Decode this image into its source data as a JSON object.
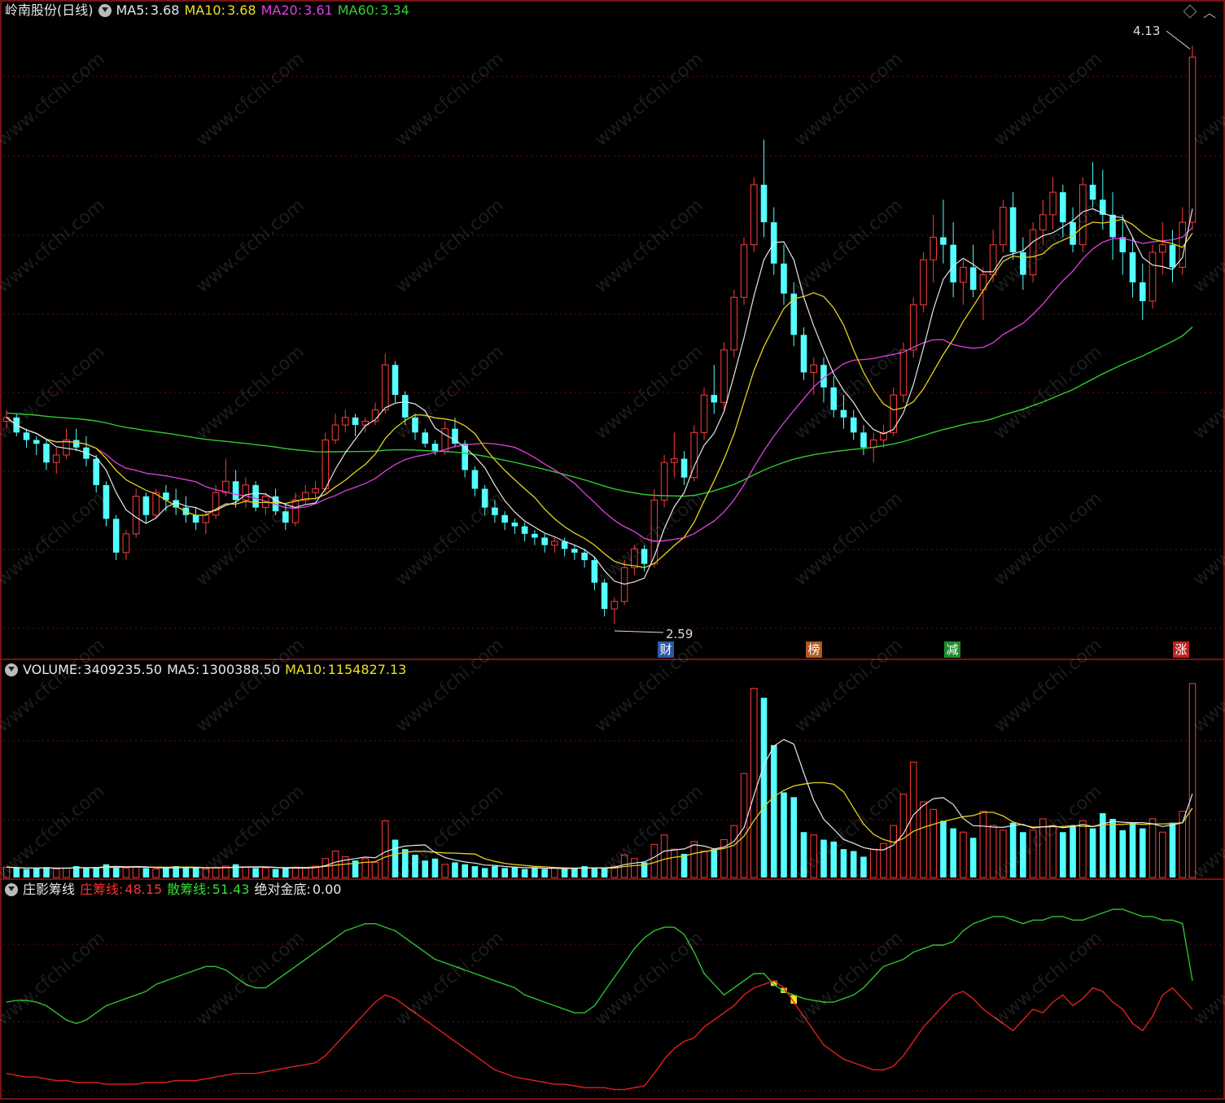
{
  "header": {
    "name": "岭南股份(日线)",
    "ma5_label": "MA5:",
    "ma5": "3.68",
    "ma10_label": "MA10:",
    "ma10": "3.68",
    "ma20_label": "MA20:",
    "ma20": "3.61",
    "ma60_label": "MA60:",
    "ma60": "3.34"
  },
  "volume_header": {
    "vol_label": "VOLUME:",
    "vol": "3409235.50",
    "ma5_label": "MA5:",
    "ma5": "1300388.50",
    "ma10_label": "MA10:",
    "ma10": "1154827.13"
  },
  "indicator_header": {
    "name": "庄影筹线",
    "zhuang_label": "庄筹线:",
    "zhuang": "48.15",
    "san_label": "散筹线:",
    "san": "51.43",
    "jd_label": "绝对金底:",
    "jd": "0.00"
  },
  "annotations": {
    "high": "4.13",
    "low": "2.59"
  },
  "tags": [
    {
      "text": "财",
      "bg": "#2a5aa8"
    },
    {
      "text": "榜",
      "bg": "#b05a20"
    },
    {
      "text": "减",
      "bg": "#208a30"
    },
    {
      "text": "涨",
      "bg": "#c02020"
    }
  ],
  "watermark": "www.cfchi.com",
  "colors": {
    "up": "#ff3b3b",
    "down": "#54ffff",
    "ma5": "#e8e8e8",
    "ma10": "#e6d21e",
    "ma20": "#e040e0",
    "ma60": "#2ecc2e",
    "border": "#a01818"
  },
  "chart_data": [
    {
      "type": "candlestick",
      "title": "岭南股份(日线)",
      "ylim": [
        2.5,
        4.2
      ],
      "count": 125,
      "ohlc": [
        [
          3.13,
          3.16,
          3.11,
          3.14
        ],
        [
          3.14,
          3.15,
          3.09,
          3.1
        ],
        [
          3.1,
          3.11,
          3.06,
          3.08
        ],
        [
          3.08,
          3.09,
          3.04,
          3.07
        ],
        [
          3.07,
          3.08,
          3.0,
          3.02
        ],
        [
          3.02,
          3.06,
          2.99,
          3.04
        ],
        [
          3.04,
          3.11,
          3.03,
          3.08
        ],
        [
          3.08,
          3.11,
          3.05,
          3.06
        ],
        [
          3.06,
          3.09,
          3.01,
          3.03
        ],
        [
          3.03,
          3.04,
          2.94,
          2.96
        ],
        [
          2.96,
          2.97,
          2.85,
          2.87
        ],
        [
          2.87,
          2.88,
          2.76,
          2.78
        ],
        [
          2.78,
          2.84,
          2.76,
          2.83
        ],
        [
          2.83,
          2.95,
          2.82,
          2.93
        ],
        [
          2.93,
          2.94,
          2.86,
          2.88
        ],
        [
          2.88,
          2.95,
          2.87,
          2.94
        ],
        [
          2.94,
          2.96,
          2.89,
          2.92
        ],
        [
          2.92,
          2.95,
          2.88,
          2.9
        ],
        [
          2.9,
          2.93,
          2.86,
          2.88
        ],
        [
          2.88,
          2.9,
          2.84,
          2.86
        ],
        [
          2.86,
          2.89,
          2.83,
          2.88
        ],
        [
          2.88,
          2.96,
          2.87,
          2.94
        ],
        [
          2.94,
          3.03,
          2.93,
          2.97
        ],
        [
          2.97,
          3.0,
          2.9,
          2.92
        ],
        [
          2.92,
          2.98,
          2.9,
          2.96
        ],
        [
          2.96,
          2.97,
          2.89,
          2.9
        ],
        [
          2.9,
          2.94,
          2.88,
          2.93
        ],
        [
          2.93,
          2.95,
          2.88,
          2.89
        ],
        [
          2.89,
          2.91,
          2.84,
          2.86
        ],
        [
          2.86,
          2.94,
          2.85,
          2.92
        ],
        [
          2.92,
          2.96,
          2.91,
          2.94
        ],
        [
          2.94,
          2.97,
          2.92,
          2.95
        ],
        [
          2.95,
          3.1,
          2.94,
          3.08
        ],
        [
          3.08,
          3.15,
          3.07,
          3.12
        ],
        [
          3.12,
          3.16,
          3.1,
          3.14
        ],
        [
          3.14,
          3.15,
          3.09,
          3.12
        ],
        [
          3.12,
          3.14,
          3.1,
          3.13
        ],
        [
          3.13,
          3.18,
          3.12,
          3.16
        ],
        [
          3.16,
          3.31,
          3.15,
          3.28
        ],
        [
          3.28,
          3.29,
          3.18,
          3.2
        ],
        [
          3.2,
          3.21,
          3.12,
          3.14
        ],
        [
          3.14,
          3.15,
          3.08,
          3.1
        ],
        [
          3.1,
          3.11,
          3.06,
          3.07
        ],
        [
          3.07,
          3.08,
          3.04,
          3.05
        ],
        [
          3.05,
          3.13,
          3.04,
          3.11
        ],
        [
          3.11,
          3.14,
          3.06,
          3.07
        ],
        [
          3.07,
          3.08,
          2.98,
          3.0
        ],
        [
          3.0,
          3.01,
          2.93,
          2.95
        ],
        [
          2.95,
          2.96,
          2.88,
          2.9
        ],
        [
          2.9,
          2.92,
          2.86,
          2.88
        ],
        [
          2.88,
          2.89,
          2.84,
          2.86
        ],
        [
          2.86,
          2.87,
          2.83,
          2.85
        ],
        [
          2.85,
          2.86,
          2.81,
          2.83
        ],
        [
          2.83,
          2.84,
          2.8,
          2.82
        ],
        [
          2.82,
          2.83,
          2.78,
          2.8
        ],
        [
          2.8,
          2.82,
          2.78,
          2.81
        ],
        [
          2.81,
          2.82,
          2.77,
          2.79
        ],
        [
          2.79,
          2.8,
          2.76,
          2.78
        ],
        [
          2.78,
          2.79,
          2.74,
          2.76
        ],
        [
          2.76,
          2.77,
          2.68,
          2.7
        ],
        [
          2.7,
          2.71,
          2.61,
          2.63
        ],
        [
          2.63,
          2.66,
          2.59,
          2.65
        ],
        [
          2.65,
          2.76,
          2.64,
          2.74
        ],
        [
          2.74,
          2.8,
          2.72,
          2.79
        ],
        [
          2.79,
          2.8,
          2.73,
          2.75
        ],
        [
          2.75,
          2.95,
          2.74,
          2.92
        ],
        [
          2.92,
          3.04,
          2.9,
          3.02
        ],
        [
          3.02,
          3.1,
          2.98,
          3.03
        ],
        [
          3.03,
          3.05,
          2.96,
          2.98
        ],
        [
          2.98,
          3.12,
          2.97,
          3.1
        ],
        [
          3.1,
          3.22,
          3.08,
          3.2
        ],
        [
          3.2,
          3.28,
          3.15,
          3.18
        ],
        [
          3.18,
          3.34,
          3.16,
          3.32
        ],
        [
          3.32,
          3.48,
          3.3,
          3.46
        ],
        [
          3.46,
          3.62,
          3.44,
          3.6
        ],
        [
          3.6,
          3.78,
          3.58,
          3.76
        ],
        [
          3.76,
          3.88,
          3.62,
          3.66
        ],
        [
          3.66,
          3.7,
          3.52,
          3.55
        ],
        [
          3.55,
          3.6,
          3.44,
          3.47
        ],
        [
          3.47,
          3.5,
          3.33,
          3.36
        ],
        [
          3.36,
          3.38,
          3.24,
          3.26
        ],
        [
          3.26,
          3.3,
          3.2,
          3.28
        ],
        [
          3.28,
          3.3,
          3.18,
          3.22
        ],
        [
          3.22,
          3.25,
          3.14,
          3.16
        ],
        [
          3.16,
          3.2,
          3.11,
          3.14
        ],
        [
          3.14,
          3.16,
          3.08,
          3.1
        ],
        [
          3.1,
          3.12,
          3.04,
          3.06
        ],
        [
          3.06,
          3.1,
          3.02,
          3.08
        ],
        [
          3.08,
          3.12,
          3.06,
          3.1
        ],
        [
          3.1,
          3.22,
          3.09,
          3.2
        ],
        [
          3.2,
          3.34,
          3.18,
          3.32
        ],
        [
          3.32,
          3.46,
          3.3,
          3.44
        ],
        [
          3.44,
          3.58,
          3.42,
          3.56
        ],
        [
          3.56,
          3.68,
          3.5,
          3.62
        ],
        [
          3.62,
          3.72,
          3.55,
          3.6
        ],
        [
          3.6,
          3.66,
          3.46,
          3.5
        ],
        [
          3.5,
          3.56,
          3.44,
          3.54
        ],
        [
          3.54,
          3.6,
          3.46,
          3.48
        ],
        [
          3.48,
          3.54,
          3.4,
          3.52
        ],
        [
          3.52,
          3.64,
          3.5,
          3.6
        ],
        [
          3.6,
          3.72,
          3.58,
          3.7
        ],
        [
          3.7,
          3.74,
          3.56,
          3.58
        ],
        [
          3.58,
          3.62,
          3.48,
          3.52
        ],
        [
          3.52,
          3.66,
          3.5,
          3.64
        ],
        [
          3.64,
          3.72,
          3.6,
          3.68
        ],
        [
          3.68,
          3.78,
          3.64,
          3.74
        ],
        [
          3.74,
          3.76,
          3.62,
          3.66
        ],
        [
          3.66,
          3.7,
          3.58,
          3.6
        ],
        [
          3.6,
          3.78,
          3.58,
          3.76
        ],
        [
          3.76,
          3.82,
          3.7,
          3.72
        ],
        [
          3.72,
          3.8,
          3.64,
          3.68
        ],
        [
          3.68,
          3.74,
          3.56,
          3.62
        ],
        [
          3.62,
          3.68,
          3.52,
          3.58
        ],
        [
          3.58,
          3.62,
          3.46,
          3.5
        ],
        [
          3.5,
          3.55,
          3.4,
          3.45
        ],
        [
          3.45,
          3.6,
          3.43,
          3.58
        ],
        [
          3.58,
          3.66,
          3.52,
          3.6
        ],
        [
          3.6,
          3.64,
          3.5,
          3.54
        ],
        [
          3.54,
          3.7,
          3.52,
          3.66
        ],
        [
          3.66,
          4.13,
          3.64,
          4.1
        ]
      ],
      "series": [
        {
          "name": "MA5"
        },
        {
          "name": "MA10"
        },
        {
          "name": "MA20"
        },
        {
          "name": "MA60"
        }
      ]
    },
    {
      "type": "bar",
      "title": "VOLUME",
      "values": [
        11,
        10,
        9,
        10,
        11,
        9,
        10,
        12,
        10,
        11,
        14,
        12,
        10,
        11,
        10,
        9,
        10,
        12,
        11,
        10,
        9,
        10,
        12,
        14,
        11,
        10,
        10,
        9,
        10,
        11,
        10,
        12,
        20,
        28,
        22,
        18,
        20,
        16,
        60,
        40,
        30,
        24,
        18,
        20,
        14,
        16,
        14,
        12,
        10,
        12,
        10,
        11,
        9,
        10,
        9,
        10,
        9,
        10,
        12,
        10,
        10,
        12,
        24,
        20,
        16,
        35,
        45,
        30,
        25,
        38,
        28,
        30,
        40,
        55,
        110,
        200,
        190,
        140,
        90,
        85,
        48,
        45,
        40,
        38,
        30,
        28,
        22,
        30,
        36,
        55,
        88,
        122,
        80,
        72,
        60,
        52,
        48,
        42,
        70,
        55,
        50,
        58,
        48,
        50,
        62,
        55,
        48,
        55,
        60,
        52,
        68,
        62,
        50,
        58,
        52,
        62,
        48,
        58,
        70,
        205
      ],
      "unit": "x10000"
    },
    {
      "type": "line",
      "title": "庄影筹线",
      "ylim": [
        0,
        100
      ],
      "series": [
        {
          "name": "庄筹线",
          "values": [
            12,
            11,
            10,
            10,
            9,
            8,
            8,
            7,
            7,
            7,
            6,
            6,
            6,
            6,
            7,
            7,
            7,
            8,
            8,
            8,
            9,
            10,
            11,
            12,
            12,
            12,
            13,
            14,
            15,
            16,
            17,
            18,
            22,
            28,
            34,
            40,
            46,
            52,
            56,
            54,
            50,
            46,
            42,
            38,
            34,
            30,
            26,
            22,
            18,
            14,
            12,
            10,
            9,
            8,
            7,
            6,
            6,
            5,
            4,
            4,
            4,
            3,
            3,
            4,
            5,
            12,
            20,
            26,
            30,
            32,
            38,
            42,
            46,
            50,
            56,
            60,
            62,
            64,
            60,
            52,
            44,
            36,
            28,
            24,
            20,
            18,
            16,
            14,
            14,
            16,
            22,
            30,
            38,
            44,
            50,
            56,
            58,
            54,
            48,
            44,
            40,
            36,
            42,
            48,
            46,
            52,
            56,
            50,
            54,
            60,
            58,
            52,
            48,
            40,
            36,
            44,
            56,
            60,
            54,
            48
          ]
        },
        {
          "name": "散筹线",
          "values": [
            52,
            53,
            53,
            52,
            50,
            46,
            42,
            40,
            42,
            46,
            50,
            52,
            54,
            56,
            58,
            62,
            64,
            66,
            68,
            70,
            72,
            72,
            70,
            66,
            62,
            60,
            60,
            64,
            68,
            72,
            76,
            80,
            84,
            88,
            92,
            94,
            96,
            96,
            94,
            92,
            88,
            84,
            80,
            76,
            74,
            72,
            70,
            68,
            66,
            64,
            62,
            60,
            56,
            54,
            52,
            50,
            48,
            46,
            46,
            50,
            58,
            66,
            74,
            82,
            88,
            92,
            94,
            94,
            90,
            80,
            68,
            62,
            56,
            60,
            64,
            68,
            68,
            62,
            58,
            56,
            54,
            53,
            52,
            52,
            54,
            56,
            60,
            66,
            72,
            74,
            76,
            80,
            82,
            84,
            84,
            86,
            92,
            96,
            98,
            100,
            100,
            98,
            96,
            98,
            98,
            100,
            100,
            98,
            98,
            100,
            102,
            104,
            104,
            102,
            100,
            100,
            98,
            98,
            96,
            64
          ]
        }
      ]
    }
  ]
}
